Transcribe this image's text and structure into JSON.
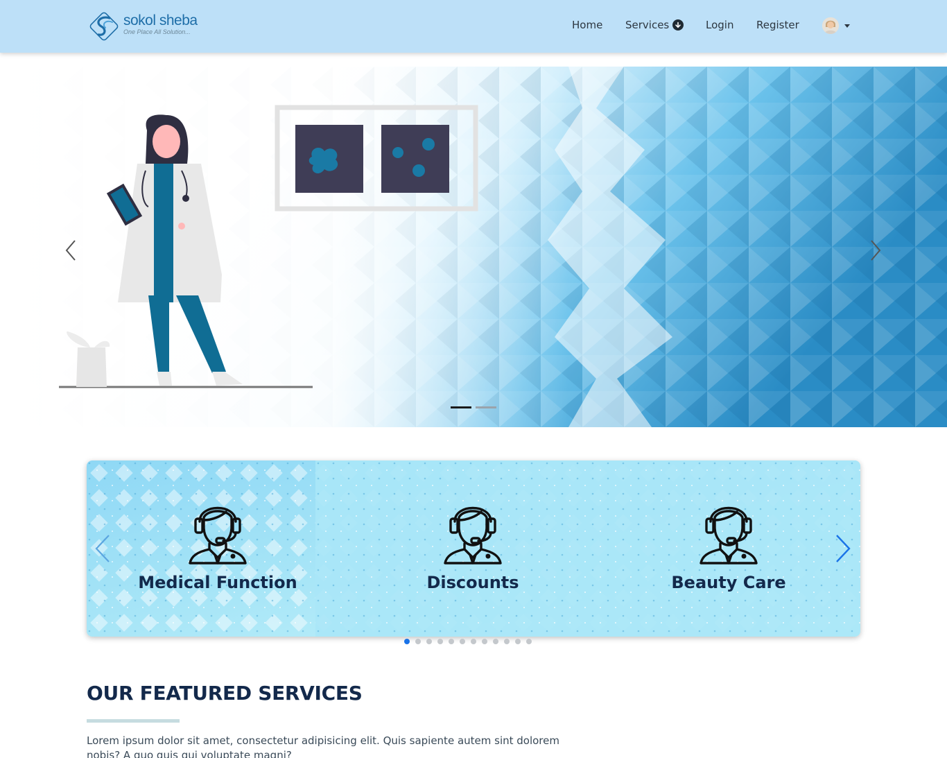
{
  "brand": {
    "name": "sokol sheba",
    "tagline": "One Place All Solution..."
  },
  "nav": {
    "home": "Home",
    "services": "Services",
    "login": "Login",
    "register": "Register"
  },
  "hero": {
    "slides_count": 2,
    "active_slide": 1
  },
  "services_slider": {
    "items": [
      {
        "label": "Medical Function",
        "icon": "customer-support-icon"
      },
      {
        "label": "Discounts",
        "icon": "customer-support-icon"
      },
      {
        "label": "Beauty Care",
        "icon": "customer-support-icon"
      }
    ],
    "dots_count": 12,
    "active_dot": 1
  },
  "featured": {
    "title": "OUR FEATURED SERVICES",
    "description": "Lorem ipsum dolor sit amet, consectetur adipisicing elit. Quis sapiente autem sint dolorem nobis? A quo quis qui voluptate magni?"
  },
  "colors": {
    "navbar": "#bde0f8",
    "brand": "#1e6ea8",
    "heading": "#13294b",
    "accent": "#1a73e8"
  }
}
